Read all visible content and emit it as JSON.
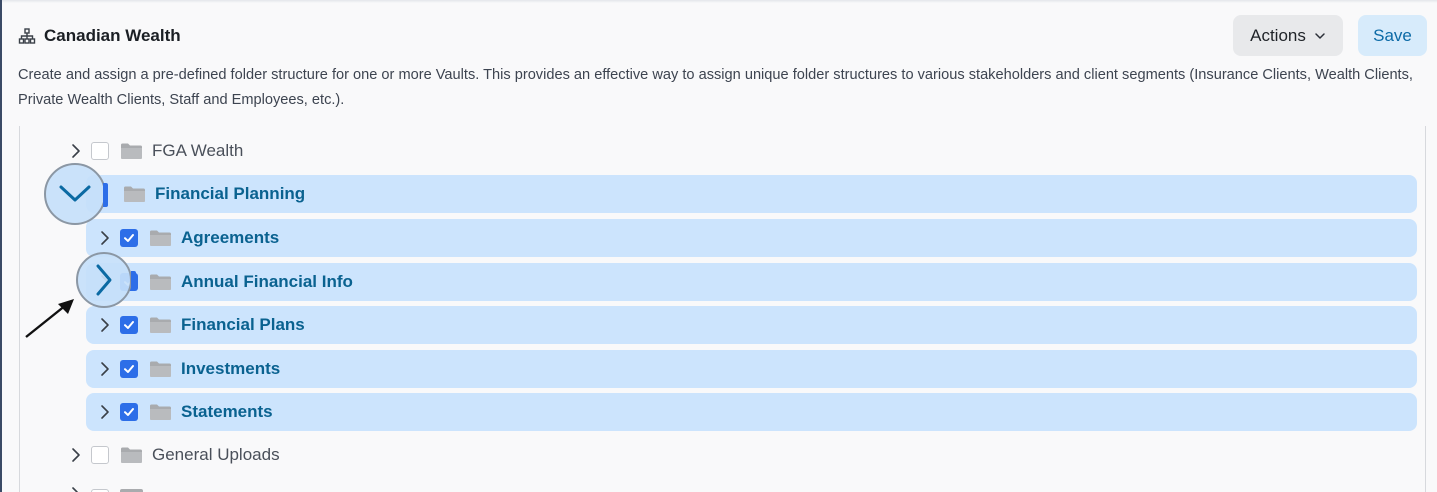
{
  "header": {
    "icon": "sitemap-icon",
    "title": "Canadian Wealth"
  },
  "toolbar": {
    "actions_label": "Actions",
    "save_label": "Save"
  },
  "description": "Create and assign a pre-defined folder structure for one or more Vaults. This provides an effective way to assign unique folder structures to various stakeholders and client segments (Insurance Clients, Wealth Clients, Private Wealth Clients, Staff and Employees, etc.).",
  "tree": {
    "rows": [
      {
        "label": "FGA Wealth",
        "selected": false,
        "checked": false,
        "expanded": false,
        "level": 0
      },
      {
        "label": "Financial Planning",
        "selected": true,
        "checked": true,
        "expanded": true,
        "level": 0
      },
      {
        "label": "Agreements",
        "selected": true,
        "checked": true,
        "expanded": false,
        "level": 1
      },
      {
        "label": "Annual Financial Info",
        "selected": true,
        "checked": true,
        "expanded": false,
        "level": 1
      },
      {
        "label": "Financial Plans",
        "selected": true,
        "checked": true,
        "expanded": false,
        "level": 1
      },
      {
        "label": "Investments",
        "selected": true,
        "checked": true,
        "expanded": false,
        "level": 1
      },
      {
        "label": "Statements",
        "selected": true,
        "checked": true,
        "expanded": false,
        "level": 1
      },
      {
        "label": "General Uploads",
        "selected": false,
        "checked": false,
        "expanded": false,
        "level": 0
      }
    ]
  },
  "colors": {
    "selected_row_bg": "#cce4fd",
    "selected_text": "#0a6290",
    "checkbox_on": "#2d6ee8",
    "save_bg": "#d7ebfb"
  }
}
